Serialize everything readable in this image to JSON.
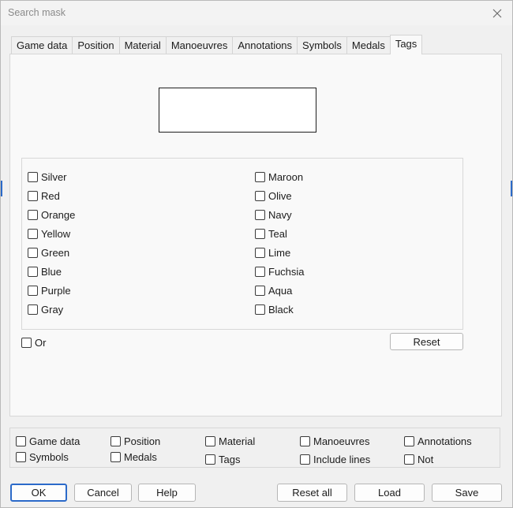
{
  "window": {
    "title": "Search mask"
  },
  "tabs": [
    "Game data",
    "Position",
    "Material",
    "Manoeuvres",
    "Annotations",
    "Symbols",
    "Medals",
    "Tags"
  ],
  "active_tab": "Tags",
  "colors_left": [
    "Silver",
    "Red",
    "Orange",
    "Yellow",
    "Green",
    "Blue",
    "Purple",
    "Gray"
  ],
  "colors_right": [
    "Maroon",
    "Olive",
    "Navy",
    "Teal",
    "Lime",
    "Fuchsia",
    "Aqua",
    "Black"
  ],
  "or_label": "Or",
  "reset_label": "Reset",
  "filters_row1": [
    "Game data",
    "Position",
    "Material",
    "Manoeuvres",
    "Annotations"
  ],
  "filters_row2": [
    "Symbols",
    "Medals",
    "Tags",
    "Include lines",
    "Not"
  ],
  "buttons": {
    "ok": "OK",
    "cancel": "Cancel",
    "help": "Help",
    "reset_all": "Reset all",
    "load": "Load",
    "save": "Save"
  }
}
